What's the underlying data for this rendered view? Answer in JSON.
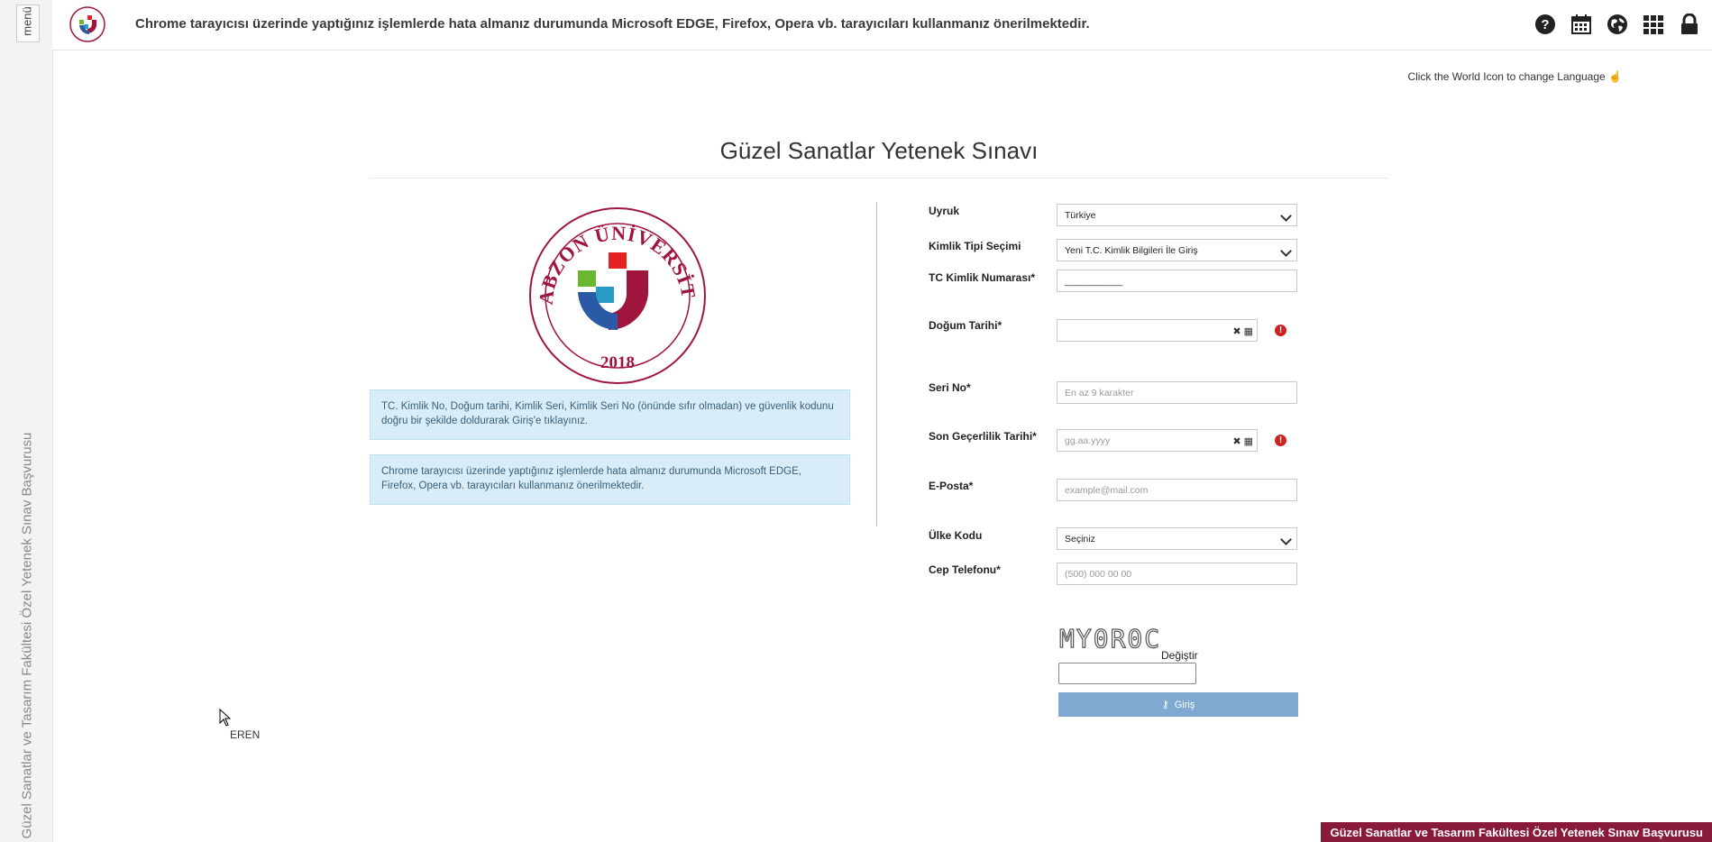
{
  "sidebar": {
    "menu_label": "menü",
    "title": "Güzel Sanatlar ve Tasarım Fakültesi Özel Yetenek Sınav Başvurusu"
  },
  "header": {
    "notice": "Chrome tarayıcısı üzerinde yaptığınız işlemlerde hata almanız durumunda Microsoft EDGE, Firefox, Opera vb. tarayıcıları kullanmanız önerilmektedir.",
    "icons": [
      "help-icon",
      "calendar-icon",
      "globe-icon",
      "grid-icon",
      "lock-icon"
    ]
  },
  "language_hint": "Click the World Icon to change Language",
  "page_title": "Güzel Sanatlar Yetenek Sınavı",
  "logo": {
    "top_text": "TRABZON ÜNİVERSİTESİ",
    "year": "2018"
  },
  "info_boxes": [
    "TC. Kimlik No, Doğum tarihi, Kimlik Seri, Kimlik Seri No (önünde sıfır olmadan) ve güvenlik kodunu doğru bir şekilde doldurarak Giriş'e tıklayınız.",
    "Chrome tarayıcısı üzerinde yaptığınız işlemlerde hata almanız durumunda Microsoft EDGE, Firefox, Opera vb. tarayıcıları kullanmanız önerilmektedir."
  ],
  "form": {
    "uyruk": {
      "label": "Uyruk",
      "value": "Türkiye"
    },
    "kimlik_tipi": {
      "label": "Kimlik Tipi Seçimi",
      "value": "Yeni T.C. Kimlik Bilgileri İle Giriş"
    },
    "tc": {
      "label": "TC Kimlik Numarası*",
      "value": "___________"
    },
    "dogum": {
      "label": "Doğum Tarihi*",
      "value": ""
    },
    "seri": {
      "label": "Seri No*",
      "placeholder": "En az 9 karakter"
    },
    "son_gecerlilik": {
      "label": "Son Geçerlilik Tarihi*",
      "placeholder": "gg.aa.yyyy"
    },
    "eposta": {
      "label": "E-Posta*",
      "placeholder": "example@mail.com"
    },
    "ulke_kodu": {
      "label": "Ülke Kodu",
      "value": "Seçiniz"
    },
    "cep": {
      "label": "Cep Telefonu*",
      "placeholder": "(500) 000 00 00"
    },
    "captcha_text": "MY0R0C",
    "captcha_change": "Değiştir",
    "login_label": "Giriş"
  },
  "user_label": "EREN",
  "footer_badge": "Güzel Sanatlar ve Tasarım Fakültesi Özel Yetenek Sınav Başvurusu",
  "colors": {
    "info_bg": "#d8edf7",
    "login_btn": "#7fa9d1",
    "footer_bg": "#8a1a3a",
    "warning": "#cc2222"
  }
}
